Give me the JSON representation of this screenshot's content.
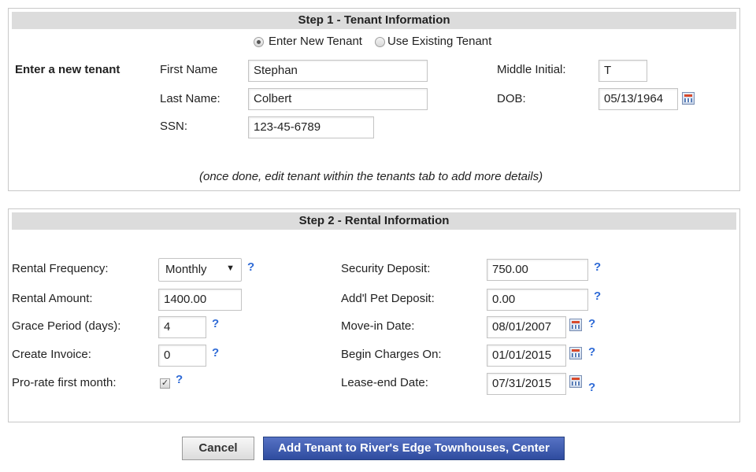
{
  "step1": {
    "header": "Step 1 - Tenant Information",
    "radio_new": "Enter New Tenant",
    "radio_existing": "Use Existing Tenant",
    "section_label": "Enter a new tenant",
    "first_name_label": "First Name",
    "first_name_value": "Stephan",
    "middle_initial_label": "Middle Initial:",
    "middle_initial_value": "T",
    "last_name_label": "Last Name:",
    "last_name_value": "Colbert",
    "dob_label": "DOB:",
    "dob_value": "05/13/1964",
    "ssn_label": "SSN:",
    "ssn_value": "123-45-6789",
    "note": "(once done, edit tenant within the tenants tab to add more details)"
  },
  "step2": {
    "header": "Step 2 - Rental Information",
    "rental_frequency_label": "Rental Frequency:",
    "rental_frequency_value": "Monthly",
    "rental_amount_label": "Rental Amount:",
    "rental_amount_value": "1400.00",
    "grace_period_label": "Grace Period (days):",
    "grace_period_value": "4",
    "create_invoice_label": "Create Invoice:",
    "create_invoice_value": "0",
    "prorate_label": "Pro-rate first month:",
    "prorate_checked": true,
    "security_deposit_label": "Security Deposit:",
    "security_deposit_value": "750.00",
    "pet_deposit_label": "Add'l Pet Deposit:",
    "pet_deposit_value": "0.00",
    "move_in_label": "Move-in Date:",
    "move_in_value": "08/01/2007",
    "begin_charges_label": "Begin Charges On:",
    "begin_charges_value": "01/01/2015",
    "lease_end_label": "Lease-end Date:",
    "lease_end_value": "07/31/2015",
    "help_glyph": "?",
    "dropdown_glyph": "▼",
    "check_glyph": "✓"
  },
  "buttons": {
    "cancel": "Cancel",
    "add": "Add Tenant to River's Edge Townhouses, Center"
  },
  "colors": {
    "help": "#2e6ad6",
    "add_button": "#3a56ad",
    "header_bar": "#dcdcdc"
  },
  "icons": [
    "calendar-icon",
    "help-icon",
    "radio-button",
    "checkbox",
    "dropdown-arrow-icon"
  ]
}
